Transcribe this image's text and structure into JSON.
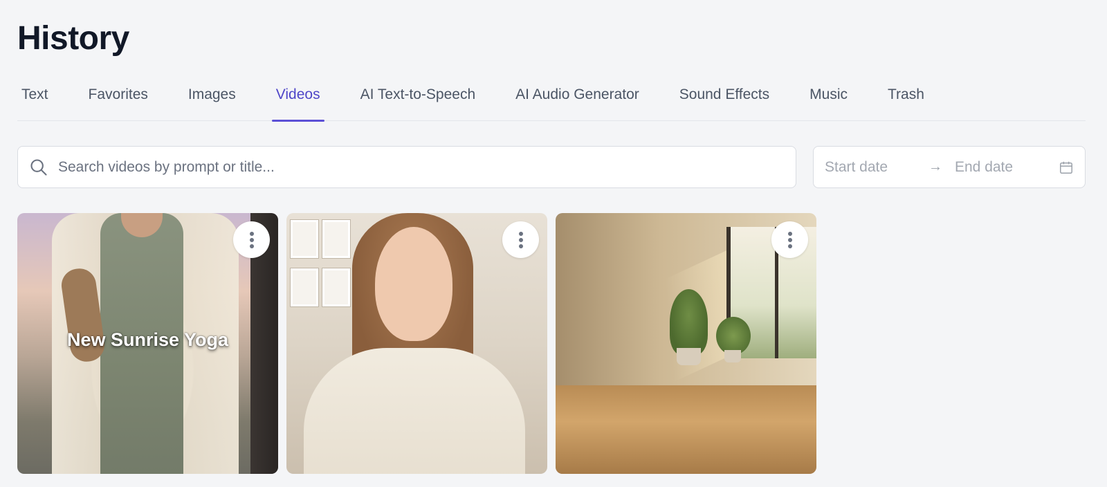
{
  "page": {
    "title": "History"
  },
  "tabs": [
    {
      "label": "Text",
      "active": false
    },
    {
      "label": "Favorites",
      "active": false
    },
    {
      "label": "Images",
      "active": false
    },
    {
      "label": "Videos",
      "active": true
    },
    {
      "label": "AI Text-to-Speech",
      "active": false
    },
    {
      "label": "AI Audio Generator",
      "active": false
    },
    {
      "label": "Sound Effects",
      "active": false
    },
    {
      "label": "Music",
      "active": false
    },
    {
      "label": "Trash",
      "active": false
    }
  ],
  "search": {
    "icon": "search-icon",
    "placeholder": "Search videos by prompt or title..."
  },
  "date_range": {
    "start_placeholder": "Start date",
    "separator": "→",
    "end_placeholder": "End date",
    "icon": "calendar-icon"
  },
  "videos": [
    {
      "title": "New Sunrise Yoga",
      "thumbnail": "woman-yoga-mat",
      "menu_icon": "more-vertical-icon"
    },
    {
      "title": "",
      "thumbnail": "woman-speaking-sweater",
      "menu_icon": "more-vertical-icon"
    },
    {
      "title": "",
      "thumbnail": "empty-room-sunlight",
      "menu_icon": "more-vertical-icon"
    }
  ],
  "colors": {
    "accent": "#5b50d6",
    "background": "#f4f5f7",
    "text": "#111827",
    "muted": "#4b5565"
  }
}
